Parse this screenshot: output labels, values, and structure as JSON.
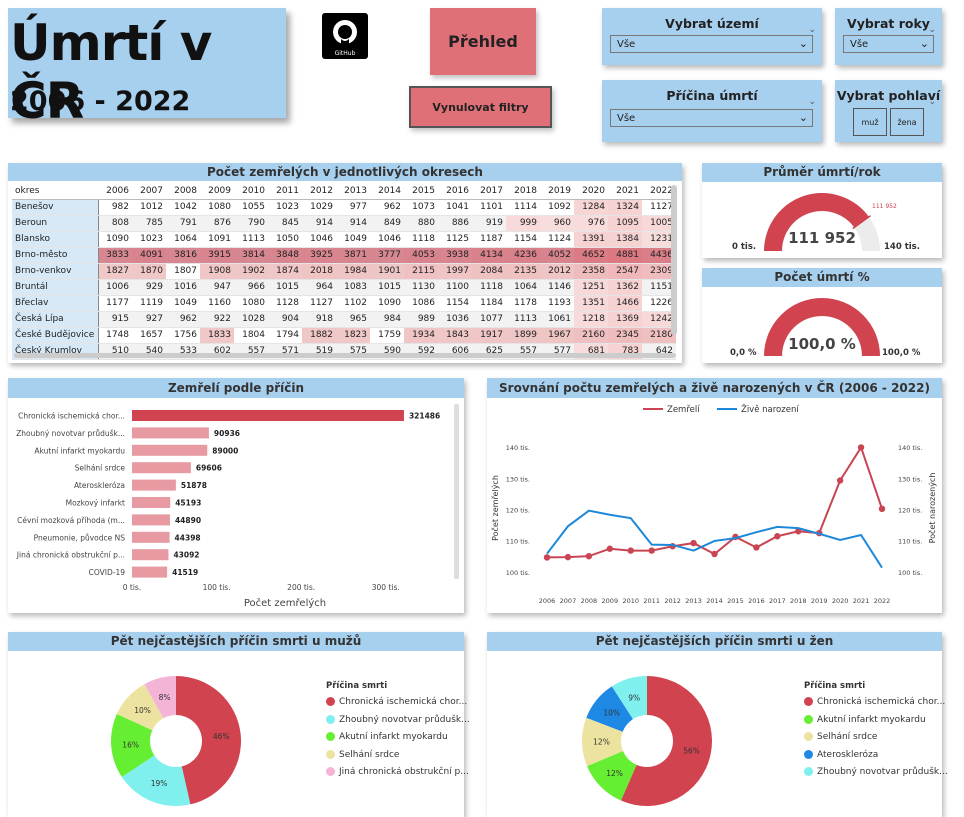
{
  "header": {
    "title": "Úmrtí v ČR",
    "years": "2006 - 2022",
    "github_label": "GitHub"
  },
  "buttons": {
    "prehled": "Přehled",
    "reset": "Vynulovat filtry"
  },
  "filters": {
    "territory": {
      "label": "Vybrat území",
      "value": "Vše"
    },
    "years": {
      "label": "Vybrat roky",
      "value": "Vše"
    },
    "cause": {
      "label": "Příčina úmrtí",
      "value": "Vše"
    },
    "gender": {
      "label": "Vybrat pohlaví",
      "options": [
        "muž",
        "žena"
      ]
    }
  },
  "district_table": {
    "title": "Počet zemřelých v jednotlivých okresech",
    "columns": [
      "okres",
      "2006",
      "2007",
      "2008",
      "2009",
      "2010",
      "2011",
      "2012",
      "2013",
      "2014",
      "2015",
      "2016",
      "2017",
      "2018",
      "2019",
      "2020",
      "2021",
      "2022"
    ],
    "rows": [
      [
        "Benešov",
        982,
        1012,
        1042,
        1080,
        1055,
        1023,
        1029,
        977,
        962,
        1073,
        1041,
        1101,
        1114,
        1092,
        1284,
        1324,
        1127
      ],
      [
        "Beroun",
        808,
        785,
        791,
        876,
        790,
        845,
        914,
        914,
        849,
        880,
        886,
        919,
        999,
        960,
        976,
        1095,
        1005
      ],
      [
        "Blansko",
        1090,
        1023,
        1064,
        1091,
        1113,
        1050,
        1046,
        1049,
        1046,
        1118,
        1125,
        1187,
        1154,
        1124,
        1391,
        1384,
        1231
      ],
      [
        "Brno-město",
        3833,
        4091,
        3816,
        3915,
        3814,
        3848,
        3925,
        3871,
        3777,
        4053,
        3938,
        4134,
        4236,
        4052,
        4652,
        4881,
        4436
      ],
      [
        "Brno-venkov",
        1827,
        1870,
        1807,
        1908,
        1902,
        1874,
        2018,
        1984,
        1901,
        2115,
        1997,
        2084,
        2135,
        2012,
        2358,
        2547,
        2309
      ],
      [
        "Bruntál",
        1006,
        929,
        1016,
        947,
        966,
        1015,
        964,
        1083,
        1015,
        1130,
        1100,
        1118,
        1064,
        1146,
        1251,
        1362,
        1151
      ],
      [
        "Břeclav",
        1177,
        1119,
        1049,
        1160,
        1080,
        1128,
        1127,
        1102,
        1090,
        1086,
        1154,
        1184,
        1178,
        1193,
        1351,
        1466,
        1226
      ],
      [
        "Česká Lípa",
        915,
        927,
        962,
        922,
        1028,
        904,
        918,
        965,
        984,
        989,
        1036,
        1077,
        1113,
        1061,
        1218,
        1369,
        1242
      ],
      [
        "České Budějovice",
        1748,
        1657,
        1756,
        1833,
        1804,
        1794,
        1882,
        1823,
        1759,
        1934,
        1843,
        1917,
        1899,
        1967,
        2160,
        2345,
        2180
      ],
      [
        "Český Krumlov",
        510,
        540,
        533,
        602,
        557,
        571,
        519,
        575,
        590,
        592,
        606,
        625,
        557,
        577,
        681,
        783,
        642
      ]
    ]
  },
  "avg_gauge": {
    "title": "Průměr úmrtí/rok",
    "value_label": "111 952",
    "target_label": "111 952",
    "min_label": "0 tis.",
    "max_label": "140 tis.",
    "fraction": 0.7997
  },
  "pct_gauge": {
    "title": "Počet úmrtí %",
    "value_label": "100,0 %",
    "min_label": "0,0 %",
    "max_label": "100,0 %",
    "fraction": 1.0
  },
  "causes_chart": {
    "title": "Zemřelí podle příčin",
    "xlabel": "Počet zemřelých",
    "ticks": [
      "0 tis.",
      "100 tis.",
      "200 tis.",
      "300 tis."
    ]
  },
  "line_chart": {
    "title": "Srovnání počtu zemřelých a živě narozených v ČR (2006 - 2022)",
    "ylabel_left": "Počet zemřelých",
    "ylabel_right": "Počet narozených",
    "yticks": [
      "100 tis.",
      "110 tis.",
      "120 tis.",
      "130 tis.",
      "140 tis."
    ]
  },
  "male_chart": {
    "title": "Pět nejčastějších příčin smrti u mužů",
    "legend_title": "Příčina smrti"
  },
  "female_chart": {
    "title": "Pět nejčastějších příčin smrti u žen",
    "legend_title": "Příčina smrti"
  },
  "chart_data": [
    {
      "type": "bar",
      "categories": [
        "Chronická ischemická chor...",
        "Zhoubný novotvar průdušk...",
        "Akutní infarkt myokardu",
        "Selhání srdce",
        "Ateroskleróza",
        "Mozkový infarkt",
        "Cévní mozková příhoda (m...",
        "Pneumonie, původce NS",
        "Jiná chronická obstrukční p...",
        "COVID-19"
      ],
      "values": [
        321486,
        90936,
        89000,
        69606,
        51878,
        45193,
        44890,
        44398,
        43092,
        41519
      ],
      "xlim": [
        0,
        340000
      ],
      "colors": [
        "#d0434f",
        "#e79aa2"
      ]
    },
    {
      "type": "line",
      "x": [
        2006,
        2007,
        2008,
        2009,
        2010,
        2011,
        2012,
        2013,
        2014,
        2015,
        2016,
        2017,
        2018,
        2019,
        2020,
        2021,
        2022
      ],
      "ylim": [
        100000,
        140000
      ],
      "series": [
        {
          "name": "Zemřelí",
          "color": "#c94553",
          "values": [
            104600,
            104700,
            105000,
            107400,
            106800,
            106800,
            108200,
            109200,
            105700,
            111200,
            107800,
            111400,
            113000,
            112400,
            129300,
            139900,
            120200
          ]
        },
        {
          "name": "Živě narození",
          "color": "#1e88d8",
          "values": [
            105800,
            114600,
            119600,
            118300,
            117200,
            108700,
            108600,
            106800,
            109900,
            110800,
            112700,
            114400,
            114000,
            112200,
            110200,
            111800,
            101300
          ]
        }
      ]
    },
    {
      "type": "pie",
      "categories": [
        "Chronická ischemická chor...",
        "Zhoubný novotvar průdušk...",
        "Akutní infarkt myokardu",
        "Selhání srdce",
        "Jiná chronická obstrukční p..."
      ],
      "values": [
        46,
        19,
        16,
        10,
        8
      ],
      "labels": [
        "46%",
        "19%",
        "16%",
        "10%",
        "8%"
      ],
      "colors": [
        "#d0434f",
        "#7ff0ee",
        "#66ee33",
        "#ede3a0",
        "#f3b4d6"
      ]
    },
    {
      "type": "pie",
      "categories": [
        "Chronická ischemická chor...",
        "Akutní infarkt myokardu",
        "Selhání srdce",
        "Ateroskleróza",
        "Zhoubný novotvar průdušk..."
      ],
      "values": [
        56,
        12,
        12,
        10,
        9
      ],
      "labels": [
        "56%",
        "12%",
        "12%",
        "10%",
        "9%"
      ],
      "colors": [
        "#d0434f",
        "#66ee33",
        "#ede3a0",
        "#1e88e5",
        "#7ff0ee"
      ]
    }
  ]
}
